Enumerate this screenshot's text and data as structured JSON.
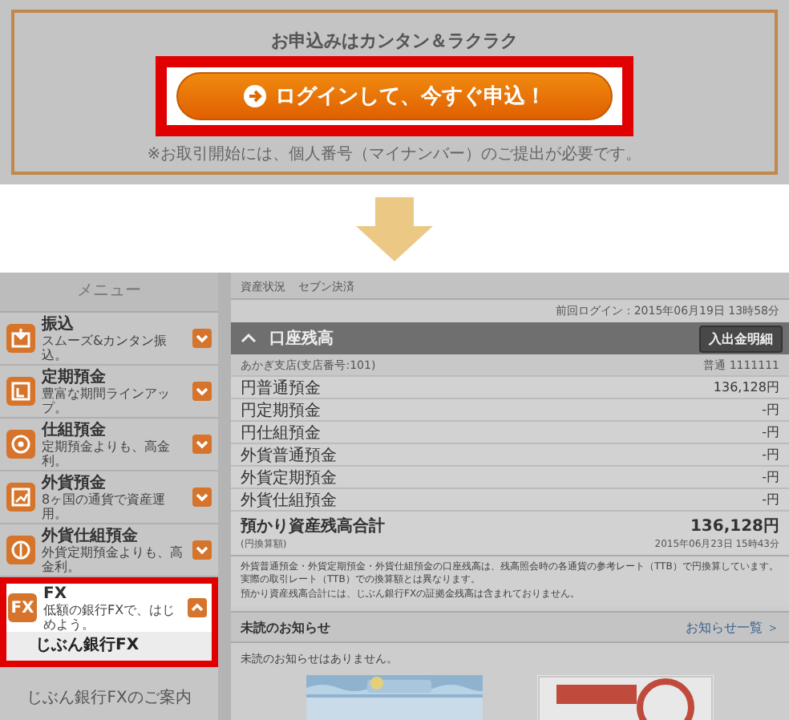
{
  "promo": {
    "title": "お申込みはカンタン＆ラクラク",
    "button": {
      "label": "ログインして、今すぐ申込！",
      "highlighted": true
    },
    "note": "※お取引開始には、個人番号（マイナンバー）のご提出が必要です。"
  },
  "sidebar": {
    "title": "メニュー",
    "items": [
      {
        "label": "振込",
        "subtitle": "スムーズ&カンタン振込。",
        "expanded": false,
        "highlighted": false
      },
      {
        "label": "定期預金",
        "subtitle": "豊富な期間ラインアップ。",
        "expanded": false,
        "highlighted": false
      },
      {
        "label": "仕組預金",
        "subtitle": "定期預金よりも、高金利。",
        "expanded": false,
        "highlighted": false
      },
      {
        "label": "外貨預金",
        "subtitle": "8ヶ国の通貨で資産運用。",
        "expanded": false,
        "highlighted": false
      },
      {
        "label": "外貨仕組預金",
        "subtitle": "外貨定期預金よりも、高金利。",
        "expanded": false,
        "highlighted": false
      },
      {
        "label": "FX",
        "badge": "FX",
        "subtitle": "低額の銀行FXで、はじめよう。",
        "expanded": true,
        "highlighted": true,
        "children": [
          "じぶん銀行FX"
        ]
      }
    ],
    "footer_link": "じぶん銀行FXのご案内"
  },
  "main": {
    "tabs": [
      "資産状況",
      "セブン決済"
    ],
    "last_login": "前回ログイン：2015年06月19日 13時58分",
    "balance": {
      "title": "口座残高",
      "button": "入出金明細",
      "branch": "あかぎ支店(支店番号:101)",
      "account": "普通 1111111",
      "rows": [
        {
          "name": "円普通預金",
          "value": "136,128円"
        },
        {
          "name": "円定期預金",
          "value": "-円"
        },
        {
          "name": "円仕組預金",
          "value": "-円"
        },
        {
          "name": "外貨普通預金",
          "value": "-円"
        },
        {
          "name": "外貨定期預金",
          "value": "-円"
        },
        {
          "name": "外貨仕組預金",
          "value": "-円"
        }
      ],
      "total": {
        "name": "預かり資産残高合計",
        "sub": "(円換算額)",
        "value": "136,128円",
        "date": "2015年06月23日 15時43分"
      },
      "notes": [
        "外貨普通預金・外貨定期預金・外貨仕組預金の口座残高は、残高照会時の各通貨の参考レート（TTB）で円換算しています。実際の取引レート（TTB）での換算額とは異なります。",
        "預かり資産残高合計には、じぶん銀行FXの証拠金残高は含まれておりません。"
      ]
    },
    "notices": {
      "title": "未読のお知らせ",
      "link": "お知らせ一覧 ＞",
      "empty": "未読のお知らせはありません。"
    }
  }
}
